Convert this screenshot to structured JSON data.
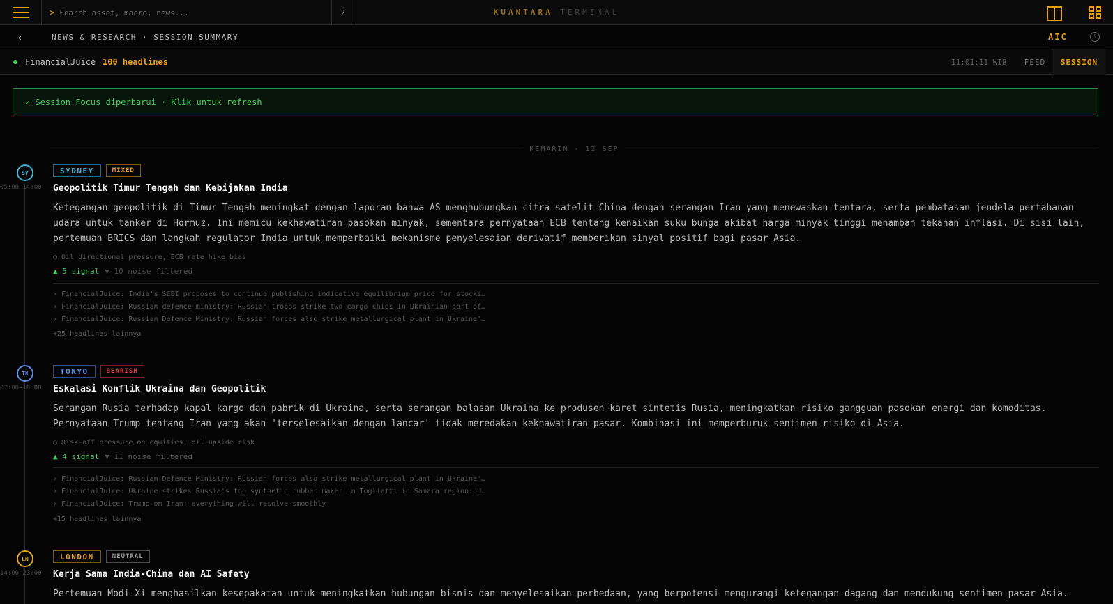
{
  "topbar": {
    "search_prompt": ">",
    "search_placeholder": "Search asset, macro, news...",
    "help_label": "?",
    "brand_primary": "KUANTARA",
    "brand_secondary": "TERMINAL"
  },
  "crumbbar": {
    "back_label": "‹",
    "title": "NEWS & RESEARCH · SESSION SUMMARY",
    "user_label": "AIC",
    "info_label": "i"
  },
  "feed": {
    "source": "FinancialJuice",
    "count": "100 headlines",
    "clock": "11:01:11 WIB",
    "tabs": [
      "FEED",
      "SESSION"
    ],
    "active_tab": "SESSION"
  },
  "banner": {
    "text": "✓ Session Focus diperbarui · Klik untuk refresh"
  },
  "date_separator": "KEMARIN · 12 SEP",
  "colors": {
    "accent": "#e5a50a",
    "signal_green": "#3ecf5a",
    "sydney": "#36b5d8",
    "tokyo": "#5b8de8",
    "london": "#e5a50a",
    "mixed": "#e5a50a",
    "bearish": "#e0433f",
    "neutral": "#9a9a9a"
  },
  "sessions": [
    {
      "node": "SY",
      "time": "05:00–14:00",
      "city": "SYDNEY",
      "mood": "MIXED",
      "title": "Geopolitik Timur Tengah dan Kebijakan India",
      "body": "Ketegangan geopolitik di Timur Tengah meningkat dengan laporan bahwa AS menghubungkan citra satelit China dengan serangan Iran yang menewaskan tentara, serta pembatasan jendela pertahanan udara untuk tanker di Hormuz. Ini memicu kekhawatiran pasokan minyak, sementara pernyataan ECB tentang kenaikan suku bunga akibat harga minyak tinggi menambah tekanan inflasi. Di sisi lain, pertemuan BRICS dan langkah regulator India untuk memperbaiki mekanisme penyelesaian derivatif memberikan sinyal positif bagi pasar Asia.",
      "bias": "○ Oil directional pressure, ECB rate hike bias",
      "signal": "▲ 5 signal",
      "noise": "▼ 10 noise filtered",
      "headlines": [
        "› FinancialJuice: India's SEBI proposes to continue publishing indicative equilibrium price for stocks…",
        "› FinancialJuice: Russian defence ministry: Russian troops strike two cargo ships in Ukrainian port of…",
        "› FinancialJuice: Russian Defence Ministry: Russian forces also strike metallurgical plant in Ukraine'…"
      ],
      "more": "+25 headlines lainnya"
    },
    {
      "node": "TK",
      "time": "07:00–16:00",
      "city": "TOKYO",
      "mood": "BEARISH",
      "title": "Eskalasi Konflik Ukraina dan Geopolitik",
      "body": "Serangan Rusia terhadap kapal kargo dan pabrik di Ukraina, serta serangan balasan Ukraina ke produsen karet sintetis Rusia, meningkatkan risiko gangguan pasokan energi dan komoditas. Pernyataan Trump tentang Iran yang akan 'terselesaikan dengan lancar' tidak meredakan kekhawatiran pasar. Kombinasi ini memperburuk sentimen risiko di Asia.",
      "bias": "○ Risk-off pressure on equities, oil upside risk",
      "signal": "▲ 4 signal",
      "noise": "▼ 11 noise filtered",
      "headlines": [
        "› FinancialJuice: Russian Defence Ministry: Russian forces also strike metallurgical plant in Ukraine'…",
        "› FinancialJuice: Ukraine strikes Russia's top synthetic rubber maker in Togliatti in Samara region: U…",
        "› FinancialJuice: Trump on Iran: everything will resolve smoothly"
      ],
      "more": "+15 headlines lainnya"
    },
    {
      "node": "LN",
      "time": "14:00–23:00",
      "city": "LONDON",
      "mood": "NEUTRAL",
      "title": "Kerja Sama India-China dan AI Safety",
      "body": "Pertemuan Modi-Xi menghasilkan kesepakatan untuk meningkatkan hubungan bisnis dan menyelesaikan perbedaan, yang berpotensi mengurangi ketegangan dagang dan mendukung sentimen pasar Asia."
    }
  ]
}
